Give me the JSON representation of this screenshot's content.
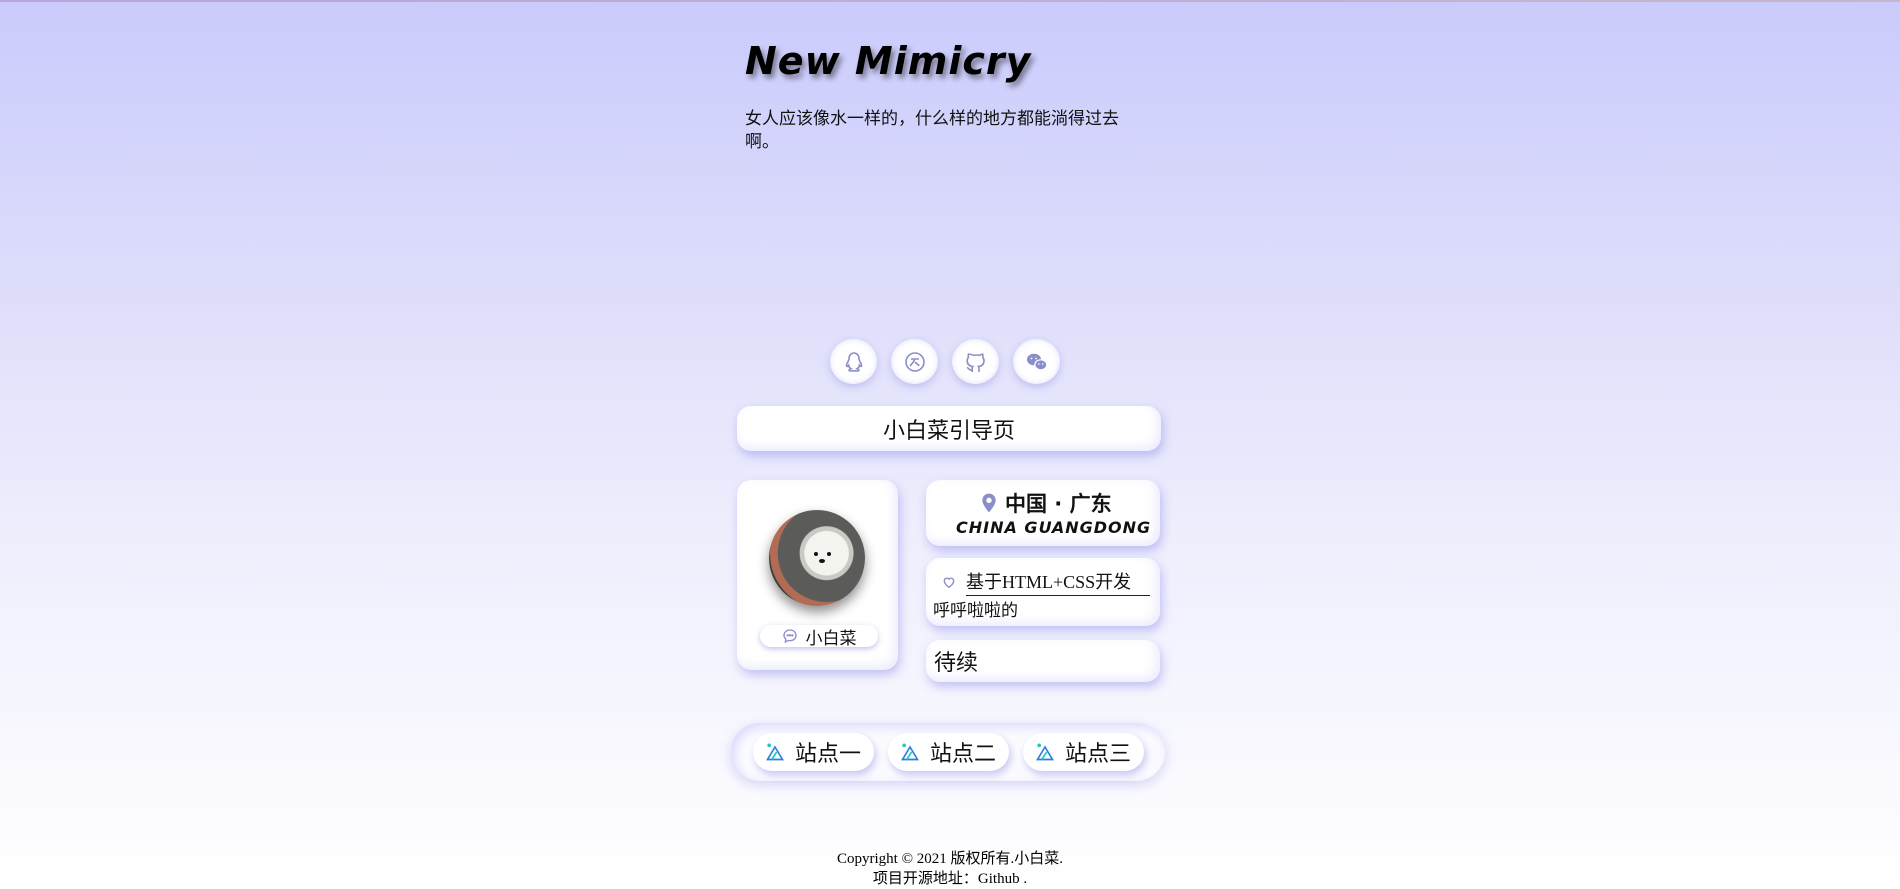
{
  "header": {
    "title": "New Mimicry",
    "subtitle": "女人应该像水一样的，什么样的地方都能淌得过去啊。"
  },
  "social": [
    {
      "name": "qq",
      "icon": "qq-penguin-icon"
    },
    {
      "name": "sina",
      "icon": "weibo-icon"
    },
    {
      "name": "github",
      "icon": "github-icon"
    },
    {
      "name": "wechat",
      "icon": "wechat-icon"
    }
  ],
  "guide": {
    "label": "小白菜引导页"
  },
  "profile": {
    "name": "小白菜",
    "icon": "chat-bubble-icon"
  },
  "location": {
    "cn": "中国 · 广东",
    "en": "CHINA GUANGDONG",
    "icon": "location-pin-icon"
  },
  "tech": {
    "line1": "基于HTML+CSS开发",
    "line2": "呼呼啦啦的",
    "icon": "heart-icon"
  },
  "todo": {
    "label": "待续"
  },
  "sites": [
    {
      "label": "站点一"
    },
    {
      "label": "站点二"
    },
    {
      "label": "站点三"
    }
  ],
  "footer": {
    "copyright": "Copyright © 2021 版权所有.小白菜.",
    "source": "项目开源地址：Github ."
  },
  "colors": {
    "icon": "#8a8fc9",
    "accent": "#1fb8d6",
    "background_top": "#cacbfc"
  }
}
